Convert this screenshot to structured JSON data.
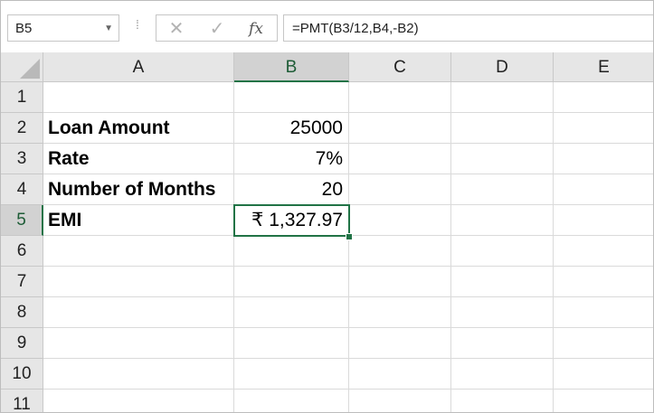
{
  "namebox": {
    "value": "B5"
  },
  "formula_bar": {
    "cancel_icon": "✕",
    "enter_icon": "✓",
    "fx_label": "fx",
    "formula": "=PMT(B3/12,B4,-B2)"
  },
  "columns": [
    "A",
    "B",
    "C",
    "D",
    "E"
  ],
  "rows": [
    "1",
    "2",
    "3",
    "4",
    "5",
    "6",
    "7",
    "8",
    "9",
    "10",
    "11"
  ],
  "cells": {
    "A2": "Loan Amount",
    "B2": "25000",
    "A3": "Rate",
    "B3": "7%",
    "A4": "Number of Months",
    "B4": "20",
    "A5": "EMI",
    "B5": "₹ 1,327.97"
  },
  "active_cell": "B5",
  "colors": {
    "accent": "#217346",
    "header_bg": "#e6e6e6",
    "active_header_bg": "#d2d2d2"
  }
}
